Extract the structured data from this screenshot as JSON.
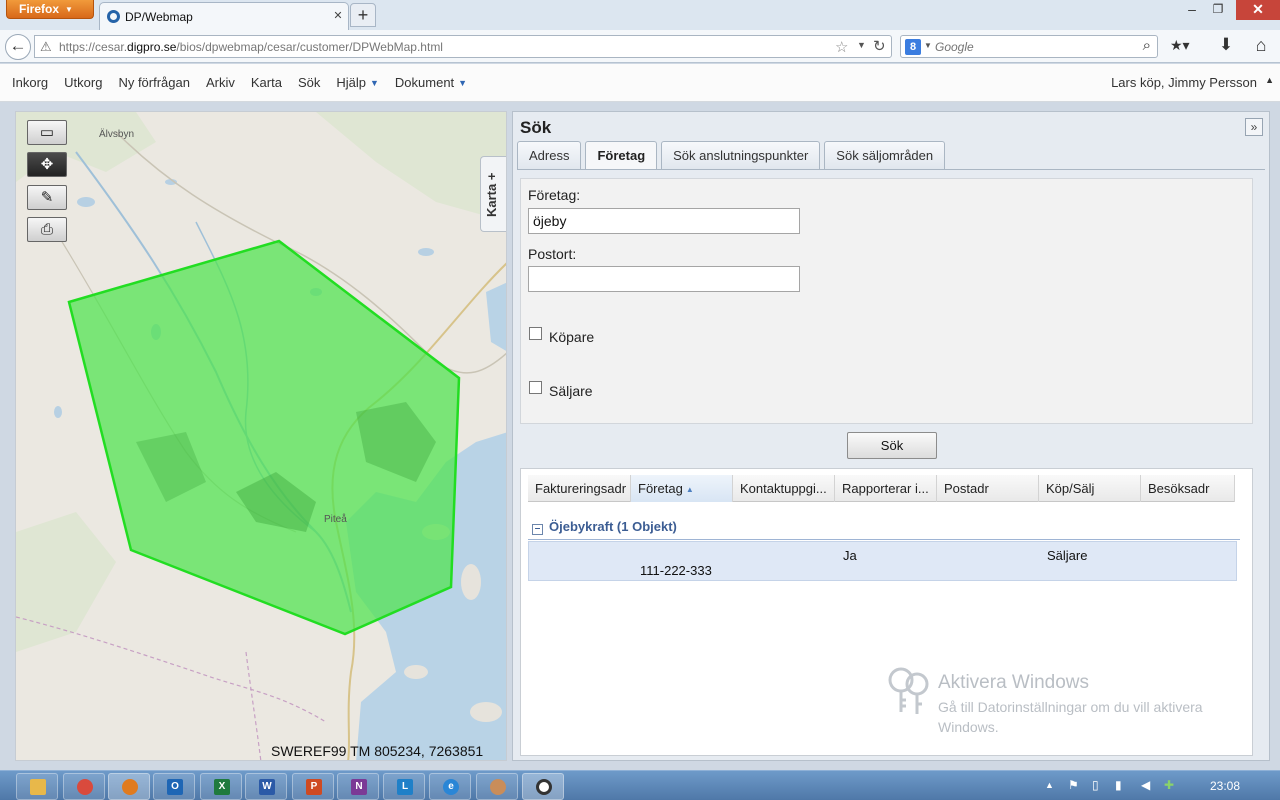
{
  "browser": {
    "firefox_label": "Firefox",
    "tab_title": "DP/Webmap",
    "url_prefix": "https://cesar.",
    "url_domain": "digpro.se",
    "url_path": "/bios/dpwebmap/cesar/customer/DPWebMap.html",
    "search_placeholder": "Google",
    "search_engine_icon": "8"
  },
  "menu": {
    "items": [
      "Inkorg",
      "Utkorg",
      "Ny förfrågan",
      "Arkiv",
      "Karta",
      "Sök"
    ],
    "dropdowns": [
      "Hjälp",
      "Dokument"
    ],
    "user": "Lars köp, Jimmy Persson"
  },
  "map": {
    "tab_label": "Karta +",
    "place_labels": [
      "Älvsbyn",
      "Piteå"
    ],
    "coordinates": "SWEREF99 TM 805234, 7263851",
    "polygon_color": "#4de34d",
    "tools": [
      "rectangle-zoom-icon",
      "pan-icon",
      "draw-icon",
      "print-icon"
    ]
  },
  "search": {
    "title": "Sök",
    "tabs": [
      "Adress",
      "Företag",
      "Sök anslutningspunkter",
      "Sök säljområden"
    ],
    "active_tab": "Företag",
    "company_label": "Företag:",
    "company_value": "öjeby",
    "postort_label": "Postort:",
    "postort_value": "",
    "buyer_label": "Köpare",
    "seller_label": "Säljare",
    "search_button": "Sök"
  },
  "results": {
    "columns": [
      "Faktureringsadr",
      "Företag",
      "Kontaktuppgi...",
      "Rapporterar i...",
      "Postadr",
      "Köp/Sälj",
      "Besöksadr"
    ],
    "sorted_column": "Företag",
    "group_label": "Öjebykraft (1 Objekt)",
    "rows": [
      {
        "rapporterar": "Ja",
        "kop_salj": "Säljare",
        "kontakt": "111-222-333"
      }
    ]
  },
  "watermark": {
    "title": "Aktivera Windows",
    "subtitle": "Gå till Datorinställningar om du vill aktivera Windows."
  },
  "taskbar": {
    "apps": [
      "explorer",
      "chrome",
      "firefox",
      "outlook",
      "excel",
      "word",
      "powerpoint",
      "onenote",
      "lync",
      "ie",
      "paint",
      "dp-webmap"
    ],
    "time": "23:08"
  }
}
